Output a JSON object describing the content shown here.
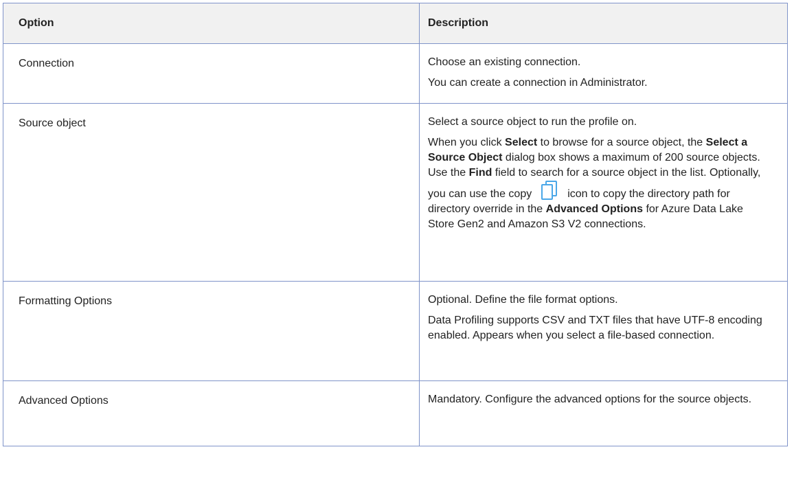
{
  "table": {
    "headers": {
      "option": "Option",
      "description": "Description"
    },
    "rows": [
      {
        "option": "Connection",
        "desc_p1": "Choose an existing connection.",
        "desc_p2": "You can create a connection in Administrator."
      },
      {
        "option": "Source object",
        "desc_p1": "Select a source object to run the profile on.",
        "desc_p2_a": "When you click ",
        "desc_p2_b1": "Select",
        "desc_p2_c": " to browse for a source object, the ",
        "desc_p2_b2": "Select a Source Object",
        "desc_p2_d": " dialog box shows a maximum of 200 source objects. Use the ",
        "desc_p2_b3": "Find",
        "desc_p2_e": " field to search for a source object in the list. Optionally, you can use the copy",
        "desc_p2_f": "icon to copy the directory path for directory override in the ",
        "desc_p2_b4": "Advanced Options",
        "desc_p2_g": " for Azure Data Lake Store Gen2 and Amazon S3 V2 connections.",
        "icon": "copy-icon"
      },
      {
        "option": "Formatting Options",
        "desc_p1": "Optional. Define the file format options.",
        "desc_p2": "Data Profiling supports CSV and TXT files that have UTF-8 encoding enabled. Appears when you select a file-based connection."
      },
      {
        "option": "Advanced Options",
        "desc_p1": "Mandatory. Configure the advanced options for the source objects."
      }
    ]
  },
  "colors": {
    "border": "#7f93c9",
    "header_bg": "#f1f1f1",
    "icon": "#4aa7e8"
  }
}
